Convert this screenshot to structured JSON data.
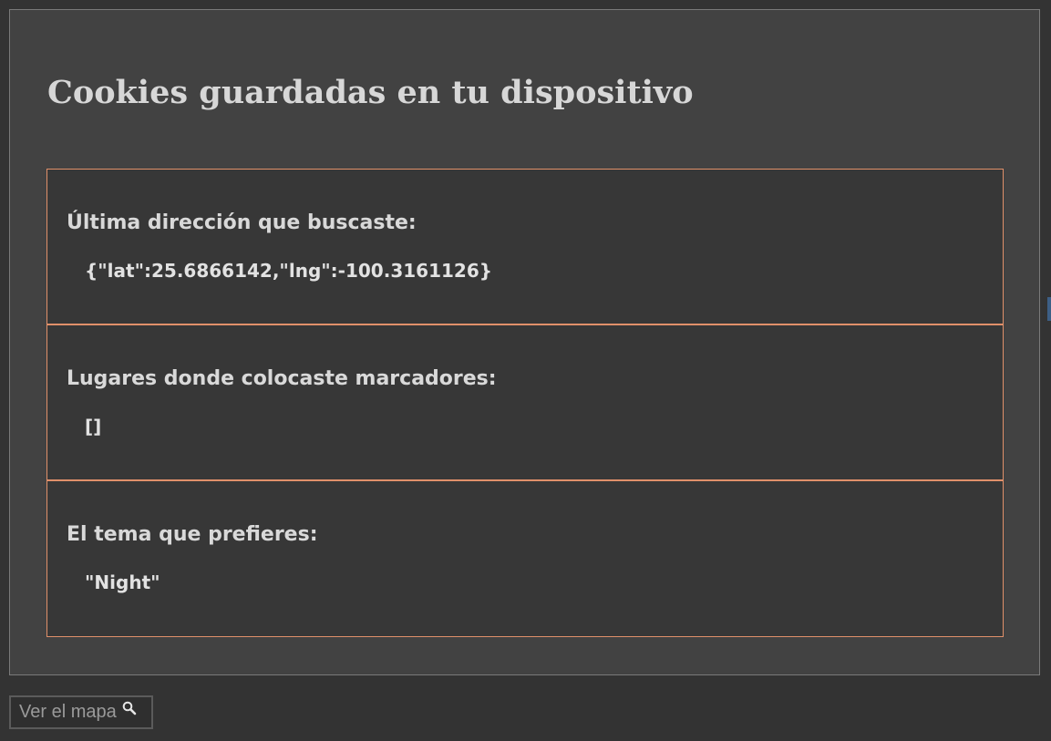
{
  "page": {
    "title": "Cookies guardadas en tu dispositivo"
  },
  "cookies": [
    {
      "label": "Última dirección que buscaste:",
      "value": "{\"lat\":25.6866142,\"lng\":-100.3161126}"
    },
    {
      "label": "Lugares donde colocaste marcadores:",
      "value": "[]"
    },
    {
      "label": "El tema que prefieres:",
      "value": "\"Night\""
    }
  ],
  "map_button": {
    "label": "Ver el mapa",
    "icon": "search-icon"
  },
  "colors": {
    "background": "#333333",
    "panel": "#424242",
    "section": "#373737",
    "accent_border": "#e0906a",
    "text": "#d9d9d9"
  }
}
